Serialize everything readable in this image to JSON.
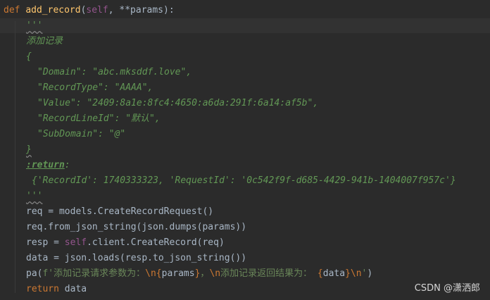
{
  "code": {
    "def_keyword": "def",
    "func_name": "add_record",
    "sig_open": "(",
    "self_kw": "self",
    "sig_rest": ", **params):",
    "doc_open": "'''",
    "doc_title": "添加记录",
    "json_open": "{",
    "json_domain": "\"Domain\": \"abc.mksddf.love\",",
    "json_record_type": "\"RecordType\": \"AAAA\",",
    "json_value": "\"Value\": \"2409:8a1e:8fc4:4650:a6da:291f:6a14:af5b\",",
    "json_line_id": "\"RecordLineId\": \"默认\",",
    "json_subdomain": "\"SubDomain\": \"@\"",
    "json_close": "}",
    "return_tag": ":return",
    "return_tag_colon": ":",
    "return_example": "{'RecordId': 1740333323, 'RequestId': '0c542f9f-d685-4429-941b-1404007f957c'}",
    "doc_close": "'''",
    "line_req": "req = models.CreateRecordRequest()",
    "line_from_json": "req.from_json_string(json.dumps(params))",
    "line_resp_a": "resp = ",
    "line_resp_self": "self",
    "line_resp_b": ".client.CreateRecord(req)",
    "line_data": "data = json.loads(resp.to_json_string())",
    "pa_call": "pa(",
    "pa_fstr_a": "f'添加记录请求参数为：",
    "pa_esc1": "\\n",
    "pa_brace_open1": "{",
    "pa_var1": "params",
    "pa_brace_close1": "}",
    "pa_fstr_b": "，",
    "pa_esc2": "\\n",
    "pa_fstr_c": "添加记录返回结果为： ",
    "pa_brace_open2": "{",
    "pa_var2": "data",
    "pa_brace_close2": "}",
    "pa_esc3": "\\n",
    "pa_fstr_d": "'",
    "pa_close": ")",
    "return_kw": "return",
    "return_val": " data"
  },
  "watermark": "CSDN @潇洒郎",
  "colors": {
    "background": "#2b2b2b",
    "keyword": "#cc7832",
    "function": "#ffc66d",
    "self": "#94558d",
    "docstring": "#629755",
    "string": "#6a8759",
    "default_text": "#a9b7c6"
  }
}
